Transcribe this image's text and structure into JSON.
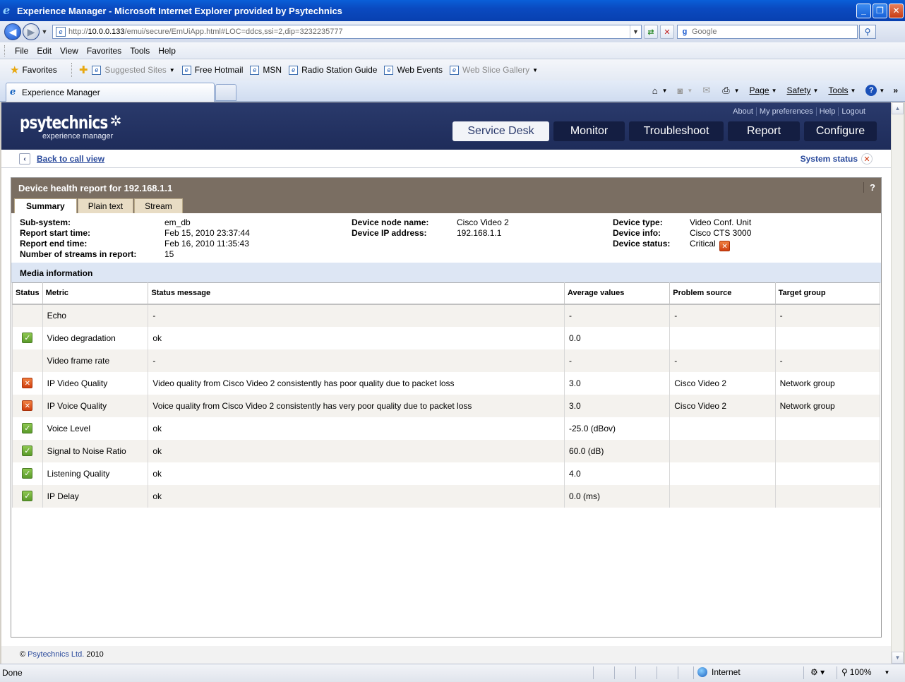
{
  "window": {
    "title": "Experience Manager - Microsoft Internet Explorer provided by Psytechnics",
    "minimize": "_",
    "maximize": "❐",
    "close": "✕"
  },
  "address": {
    "url_prefix": "http://",
    "url_host": "10.0.0.133",
    "url_path": "/emui/secure/EmUiApp.html#LOC=ddcs,ssi=2,dip=3232235777",
    "search_placeholder": "Google"
  },
  "menu": [
    "File",
    "Edit",
    "View",
    "Favorites",
    "Tools",
    "Help"
  ],
  "favorites_bar": {
    "favorites_label": "Favorites",
    "items": [
      {
        "label": "Suggested Sites",
        "dropdown": true,
        "grey": true
      },
      {
        "label": "Free Hotmail",
        "dropdown": false,
        "grey": false
      },
      {
        "label": "MSN",
        "dropdown": false,
        "grey": false
      },
      {
        "label": "Radio Station Guide",
        "dropdown": false,
        "grey": false
      },
      {
        "label": "Web Events",
        "dropdown": false,
        "grey": false
      },
      {
        "label": "Web Slice Gallery",
        "dropdown": true,
        "grey": true
      }
    ]
  },
  "tabs": {
    "active_label": "Experience Manager"
  },
  "command_bar": {
    "page": "Page",
    "safety": "Safety",
    "tools": "Tools",
    "help": "?"
  },
  "app": {
    "brand": "psytechnics",
    "brand_sub": "experience manager",
    "top_links": [
      "About",
      "My preferences",
      "Help",
      "Logout"
    ],
    "nav": [
      {
        "label": "Service Desk",
        "active": true
      },
      {
        "label": "Monitor",
        "active": false
      },
      {
        "label": "Troubleshoot",
        "active": false
      },
      {
        "label": "Report",
        "active": false
      },
      {
        "label": "Configure",
        "active": false
      }
    ],
    "back_link": "Back to call view",
    "system_status": "System status"
  },
  "report": {
    "title": "Device health report for 192.168.1.1",
    "help": "?",
    "subtabs": [
      {
        "label": "Summary",
        "active": true
      },
      {
        "label": "Plain text",
        "active": false
      },
      {
        "label": "Stream",
        "active": false
      }
    ],
    "info": {
      "subsystem_label": "Sub-system:",
      "subsystem": "em_db",
      "start_label": "Report start time:",
      "start": "Feb 15, 2010 23:37:44",
      "end_label": "Report end time:",
      "end": "Feb 16, 2010 11:35:43",
      "streams_label": "Number of streams in report:",
      "streams": "15",
      "node_label": "Device node name:",
      "node": "Cisco Video 2",
      "ip_label": "Device IP address:",
      "ip": "192.168.1.1",
      "type_label": "Device type:",
      "type": "Video Conf. Unit",
      "devinfo_label": "Device info:",
      "devinfo": "Cisco CTS 3000",
      "status_label": "Device status:",
      "status": "Critical"
    },
    "media_heading": "Media information",
    "columns": [
      "Status",
      "Metric",
      "Status message",
      "Average values",
      "Problem source",
      "Target group"
    ],
    "rows": [
      {
        "status": "none",
        "metric": "Echo",
        "message": "-",
        "average": "-",
        "source": "-",
        "group": "-"
      },
      {
        "status": "ok",
        "metric": "Video degradation",
        "message": "ok",
        "average": "0.0",
        "source": "",
        "group": ""
      },
      {
        "status": "none",
        "metric": "Video frame rate",
        "message": "-",
        "average": "-",
        "source": "-",
        "group": "-"
      },
      {
        "status": "critical",
        "metric": "IP Video Quality",
        "message": "Video quality from Cisco Video 2 consistently has poor quality due to packet loss",
        "average": "3.0",
        "source": "Cisco Video 2",
        "group": "Network group"
      },
      {
        "status": "critical",
        "metric": "IP Voice Quality",
        "message": "Voice quality from Cisco Video 2 consistently has very poor quality due to packet loss",
        "average": "3.0",
        "source": "Cisco Video 2",
        "group": "Network group"
      },
      {
        "status": "ok",
        "metric": "Voice Level",
        "message": "ok",
        "average": "-25.0 (dBov)",
        "source": "",
        "group": ""
      },
      {
        "status": "ok",
        "metric": "Signal to Noise Ratio",
        "message": "ok",
        "average": "60.0 (dB)",
        "source": "",
        "group": ""
      },
      {
        "status": "ok",
        "metric": "Listening Quality",
        "message": "ok",
        "average": "4.0",
        "source": "",
        "group": ""
      },
      {
        "status": "ok",
        "metric": "IP Delay",
        "message": "ok",
        "average": "0.0 (ms)",
        "source": "",
        "group": ""
      }
    ]
  },
  "footer": {
    "copyright": "©",
    "company": "Psytechnics Ltd.",
    "year": "2010"
  },
  "statusbar": {
    "text": "Done",
    "zone": "Internet",
    "zoom": "100%"
  },
  "colors": {
    "header_navy": "#1e2c5a",
    "panel_brown": "#7a6e62",
    "critical": "#d04010",
    "ok": "#5a9a2a"
  }
}
